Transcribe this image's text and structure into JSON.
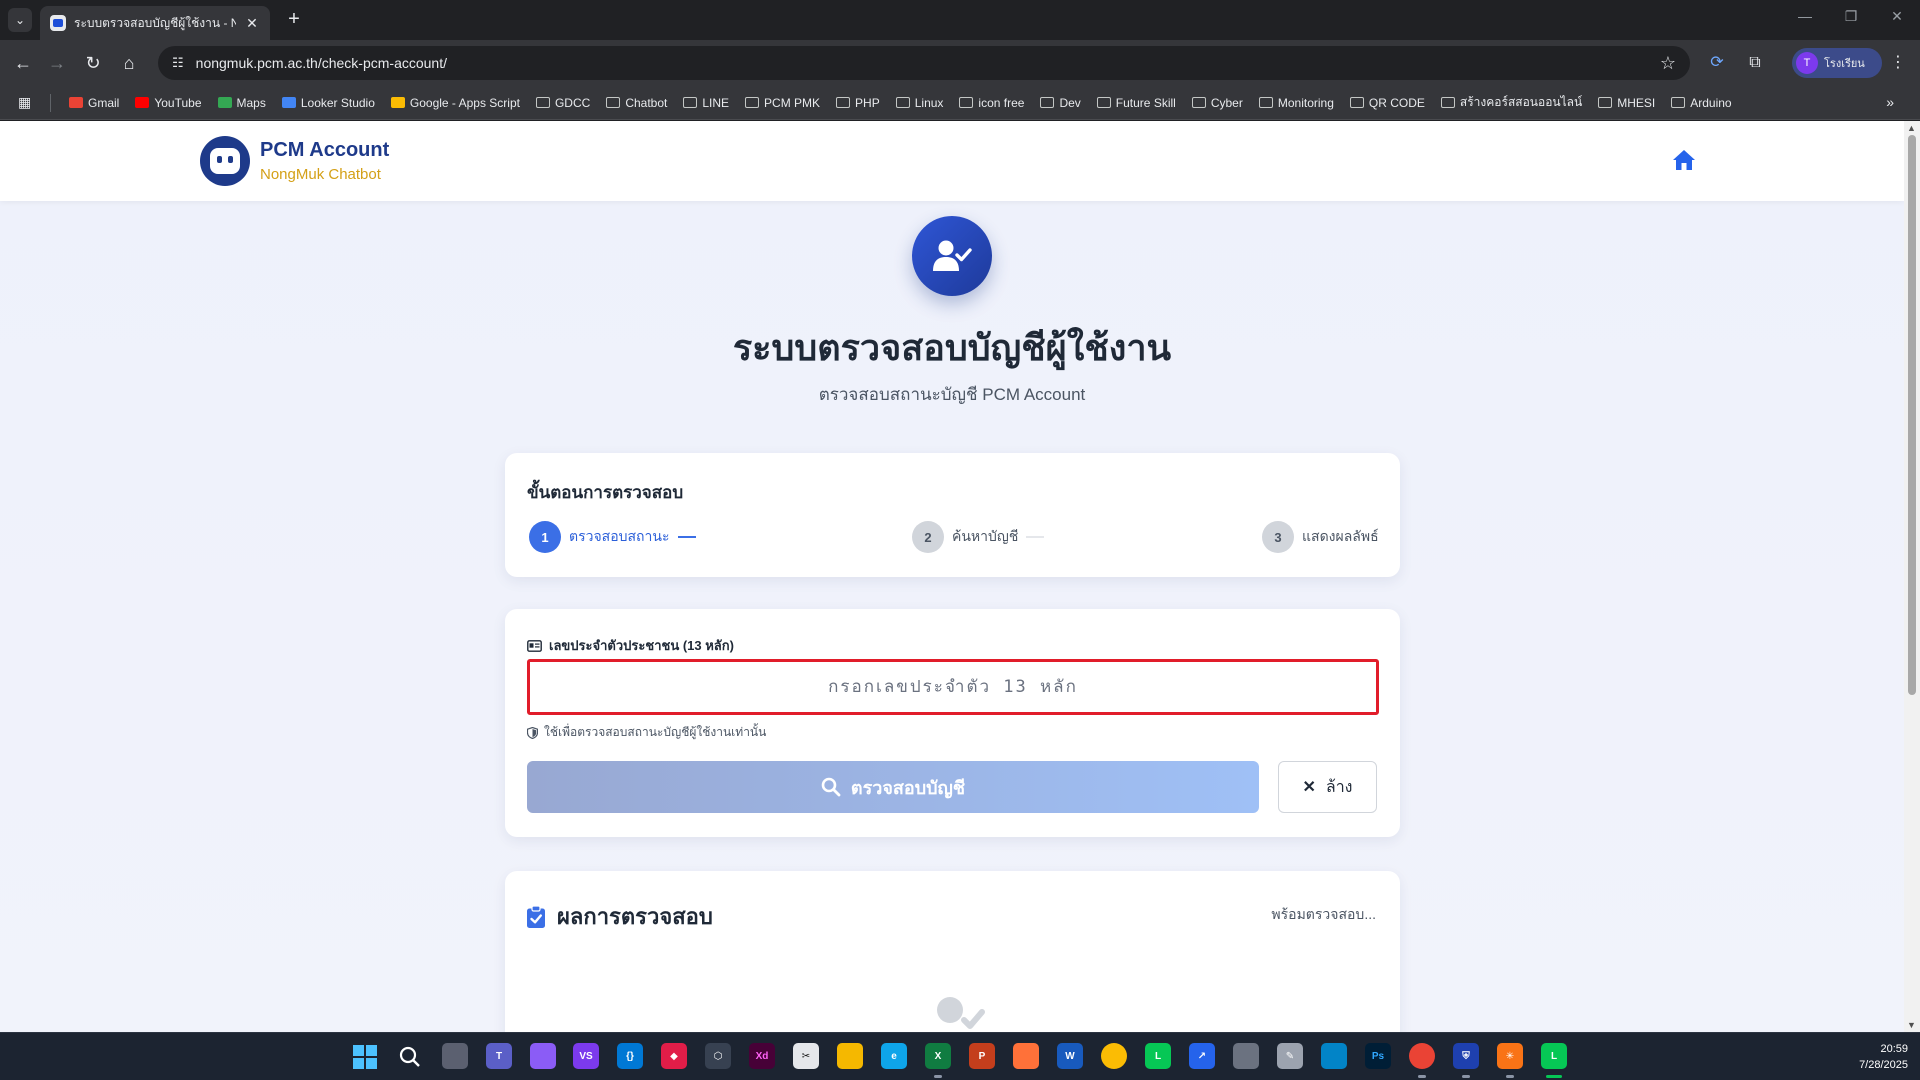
{
  "browser": {
    "tab_title": "ระบบตรวจสอบบัญชีผู้ใช้งาน - NongMuk",
    "url": "nongmuk.pcm.ac.th/check-pcm-account/",
    "profile_initial": "T",
    "profile_name": "โรงเรียน"
  },
  "bookmarks": [
    {
      "label": "Gmail",
      "icon": "gmail-icon",
      "color": "#ea4335"
    },
    {
      "label": "YouTube",
      "icon": "youtube-icon",
      "color": "#ff0000"
    },
    {
      "label": "Maps",
      "icon": "maps-icon",
      "color": "#34a853"
    },
    {
      "label": "Looker Studio",
      "icon": "looker-icon",
      "color": "#4285f4"
    },
    {
      "label": "Google - Apps Script",
      "icon": "apps-script-icon",
      "color": "#fbbc04"
    },
    {
      "label": "GDCC",
      "icon": "folder-icon"
    },
    {
      "label": "Chatbot",
      "icon": "folder-icon"
    },
    {
      "label": "LINE",
      "icon": "folder-icon"
    },
    {
      "label": "PCM PMK",
      "icon": "folder-icon"
    },
    {
      "label": "PHP",
      "icon": "folder-icon"
    },
    {
      "label": "Linux",
      "icon": "folder-icon"
    },
    {
      "label": "icon free",
      "icon": "folder-icon"
    },
    {
      "label": "Dev",
      "icon": "folder-icon"
    },
    {
      "label": "Future Skill",
      "icon": "folder-icon"
    },
    {
      "label": "Cyber",
      "icon": "folder-icon"
    },
    {
      "label": "Monitoring",
      "icon": "folder-icon"
    },
    {
      "label": "QR CODE",
      "icon": "folder-icon"
    },
    {
      "label": "สร้างคอร์สสอนออนไลน์",
      "icon": "folder-icon"
    },
    {
      "label": "MHESI",
      "icon": "folder-icon"
    },
    {
      "label": "Arduino",
      "icon": "folder-icon"
    }
  ],
  "header": {
    "brand_title": "PCM Account",
    "brand_subtitle": "NongMuk Chatbot"
  },
  "hero": {
    "title": "ระบบตรวจสอบบัญชีผู้ใช้งาน",
    "subtitle": "ตรวจสอบสถานะบัญชี PCM Account"
  },
  "steps": {
    "title": "ขั้นตอนการตรวจสอบ",
    "items": [
      {
        "num": "1",
        "label": "ตรวจสอบสถานะ",
        "state": "active"
      },
      {
        "num": "2",
        "label": "ค้นหาบัญชี",
        "state": "inactive"
      },
      {
        "num": "3",
        "label": "แสดงผลลัพธ์",
        "state": "inactive"
      }
    ]
  },
  "form": {
    "id_label": "เลขประจำตัวประชาชน (13 หลัก)",
    "id_placeholder": "กรอกเลขประจำตัว 13 หลัก",
    "id_value": "",
    "hint": "ใช้เพื่อตรวจสอบสถานะบัญชีผู้ใช้งานเท่านั้น",
    "check_button": "ตรวจสอบบัญชี",
    "clear_button": "ล้าง"
  },
  "result": {
    "title": "ผลการตรวจสอบ",
    "status": "พร้อมตรวจสอบ..."
  },
  "taskbar": {
    "time": "20:59",
    "date": "7/28/2025"
  },
  "colors": {
    "brand_navy": "#1e3a8a",
    "brand_gold": "#d4a017",
    "accent_blue": "#3b6fe6",
    "input_border": "#e11d2a"
  }
}
